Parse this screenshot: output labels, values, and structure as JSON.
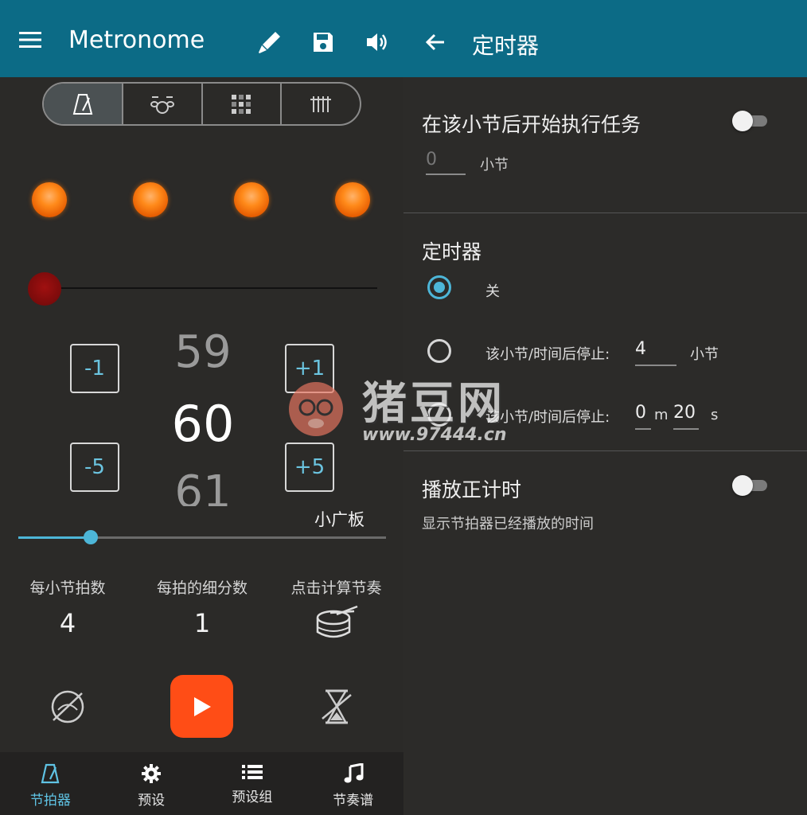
{
  "left": {
    "appbar": {
      "title": "Metronome",
      "icons": [
        "menu-icon",
        "brush-icon",
        "save-icon",
        "volume-icon"
      ]
    },
    "modes": [
      "metronome-icon",
      "drumkit-icon",
      "grid-icon",
      "mixer-icon"
    ],
    "bpm": {
      "prev": "59",
      "current": "60",
      "next": "61"
    },
    "steps": {
      "minus1": "-1",
      "minus5": "-5",
      "plus1": "+1",
      "plus5": "+5"
    },
    "tempo_name": "小广板",
    "tempo_slider_fraction": 0.2,
    "beats_per_bar_label": "每小节拍数",
    "beats_per_bar_value": "4",
    "subdivision_label": "每拍的细分数",
    "subdivision_value": "1",
    "tap_tempo_label": "点击计算节奏",
    "nav": [
      "节拍器",
      "预设",
      "预设组",
      "节奏谱"
    ]
  },
  "right": {
    "appbar": {
      "title": "定时器"
    },
    "start_after_bar_label": "在该小节后开始执行任务",
    "start_bar_value": "0",
    "bar_unit": "小节",
    "timer_header": "定时器",
    "option_off": "关",
    "option_bars_label": "该小节/时间后停止:",
    "option_bars_value": "4",
    "option_bars_unit": "小节",
    "option_time_label": "该小节/时间后停止:",
    "option_time_minutes": "0",
    "option_time_m": "m",
    "option_time_seconds": "20",
    "option_time_s": "s",
    "count_up_label": "播放正计时",
    "count_up_desc": "显示节拍器已经播放的时间"
  },
  "watermark": {
    "text": "猪豆网",
    "url": "www.97444.cn"
  },
  "colors": {
    "appbar": "#0c6b86",
    "accent": "#4db6d8",
    "play": "#ff4d16",
    "beat": "#ff8a1a"
  }
}
